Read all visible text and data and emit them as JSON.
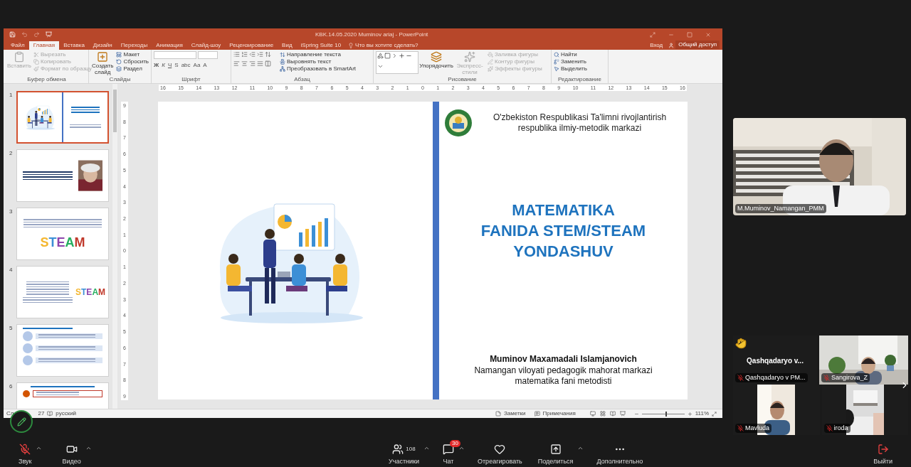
{
  "powerpoint": {
    "title": "KBK.14.05.2020 Muminov ariaj - PowerPoint",
    "tabs": [
      {
        "label": "Файл",
        "selected": false
      },
      {
        "label": "Главная",
        "selected": true
      },
      {
        "label": "Вставка",
        "selected": false
      },
      {
        "label": "Дизайн",
        "selected": false
      },
      {
        "label": "Переходы",
        "selected": false
      },
      {
        "label": "Анимация",
        "selected": false
      },
      {
        "label": "Слайд-шоу",
        "selected": false
      },
      {
        "label": "Рецензирование",
        "selected": false
      },
      {
        "label": "Вид",
        "selected": false
      },
      {
        "label": "iSpring Suite 10",
        "selected": false
      }
    ],
    "tell_me": "Что вы хотите сделать?",
    "sign_in": "Вход",
    "share": "Общий доступ",
    "ribbon": [
      {
        "label": "Буфер обмена",
        "large": [
          {
            "label": "Вставить",
            "disabled": true
          }
        ],
        "small": [
          {
            "label": "Вырезать",
            "disabled": true
          },
          {
            "label": "Копировать",
            "disabled": true
          },
          {
            "label": "Формат по образцу",
            "disabled": true
          }
        ]
      },
      {
        "label": "Слайды",
        "large": [
          {
            "label": "Создать слайд",
            "disabled": false
          }
        ],
        "small": [
          {
            "label": "Макет",
            "disabled": false
          },
          {
            "label": "Сбросить",
            "disabled": false
          },
          {
            "label": "Раздел",
            "disabled": false
          }
        ]
      },
      {
        "label": "Шрифт",
        "font_buttons": [
          "Ж",
          "К",
          "Ч",
          "S",
          "abc",
          "Aa",
          "A"
        ]
      },
      {
        "label": "Абзац",
        "small": [
          {
            "label": "Направление текста",
            "disabled": false
          },
          {
            "label": "Выровнять текст",
            "disabled": false
          },
          {
            "label": "Преобразовать в SmartArt",
            "disabled": false
          }
        ]
      },
      {
        "label": "Рисование",
        "large": [
          {
            "label": "Упорядочить",
            "disabled": false
          },
          {
            "label": "Экспресс-стили",
            "disabled": true
          }
        ],
        "small": [
          {
            "label": "Заливка фигуры",
            "disabled": true
          },
          {
            "label": "Контур фигуры",
            "disabled": true
          },
          {
            "label": "Эффекты фигуры",
            "disabled": true
          }
        ]
      },
      {
        "label": "Редактирование",
        "small": [
          {
            "label": "Найти",
            "disabled": false
          },
          {
            "label": "Заменить",
            "disabled": false
          },
          {
            "label": "Выделить",
            "disabled": false
          }
        ]
      }
    ],
    "h_ruler": [
      "16",
      "15",
      "14",
      "13",
      "12",
      "11",
      "10",
      "9",
      "8",
      "7",
      "6",
      "5",
      "4",
      "3",
      "2",
      "1",
      "0",
      "1",
      "2",
      "3",
      "4",
      "5",
      "6",
      "7",
      "8",
      "9",
      "10",
      "11",
      "12",
      "13",
      "14",
      "15",
      "16"
    ],
    "v_ruler": [
      "9",
      "8",
      "7",
      "6",
      "5",
      "4",
      "3",
      "2",
      "1",
      "0",
      "1",
      "2",
      "3",
      "4",
      "5",
      "6",
      "7",
      "8",
      "9"
    ],
    "thumbnails": [
      {
        "number": "1",
        "selected": true,
        "kind": "title"
      },
      {
        "number": "2",
        "selected": false,
        "kind": "quote"
      },
      {
        "number": "3",
        "selected": false,
        "kind": "logo",
        "logo": "STEAM"
      },
      {
        "number": "4",
        "selected": false,
        "kind": "list",
        "logo": "STEAM"
      },
      {
        "number": "5",
        "selected": false,
        "kind": "essence"
      },
      {
        "number": "6",
        "selected": false,
        "kind": "section"
      }
    ],
    "slide": {
      "org": "O'zbekiston Respublikasi Ta'limni rivojlantirish respublika ilmiy-metodik markazi",
      "title": [
        "MATEMATIKA",
        "FANIDA STEM/STEAM",
        "YONDASHUV"
      ],
      "author": "Muminov Maxamadali Islamjanovich",
      "position": [
        "Namangan viloyati pedagogik mahorat markazi",
        "matematika fani metodisti"
      ]
    },
    "status": {
      "slide_start": "Сл",
      "slide_end": "27",
      "language": "русский",
      "notes": "Заметки",
      "comments": "Примечания",
      "zoom": "111%",
      "level": 0.55
    }
  },
  "participants": {
    "speaker": "M.Muminov_Namangan_PMM",
    "tiles": [
      {
        "kind": "avatar",
        "title": "Qashqadaryo  v...",
        "name": "Qashqadaryo v PM...",
        "hand_raised": true,
        "muted": true
      },
      {
        "kind": "video",
        "name": "Sangirova_Z",
        "hand_raised": false,
        "muted": true
      },
      {
        "kind": "video",
        "name": "Mavluda",
        "hand_raised": false,
        "muted": true
      },
      {
        "kind": "video",
        "name": "iroda",
        "hand_raised": false,
        "muted": true
      }
    ]
  },
  "toolbar": {
    "left": [
      {
        "label": "Звук",
        "kind": "mic_off"
      },
      {
        "label": "Видео",
        "kind": "video"
      }
    ],
    "center": [
      {
        "label": "Участники",
        "kind": "participants",
        "count": "108"
      },
      {
        "label": "Чат",
        "kind": "chat",
        "badge": "30"
      },
      {
        "label": "Отреагировать",
        "kind": "react"
      },
      {
        "label": "Поделиться",
        "kind": "share"
      },
      {
        "label": "Дополнительно",
        "kind": "more"
      }
    ],
    "right": [
      {
        "label": "Выйти",
        "kind": "leave"
      }
    ]
  }
}
